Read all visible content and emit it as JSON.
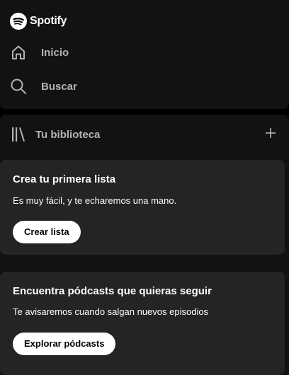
{
  "brand": {
    "name": "Spotify",
    "icon": "spotify-logo-icon",
    "color": "#1ed760"
  },
  "nav": {
    "items": [
      {
        "label": "Inicio",
        "icon": "home-icon"
      },
      {
        "label": "Buscar",
        "icon": "search-icon"
      }
    ]
  },
  "library": {
    "title": "Tu biblioteca",
    "icon": "library-icon",
    "add_icon": "plus-icon",
    "cards": [
      {
        "title": "Crea tu primera lista",
        "text": "Es muy fácil, y te echaremos una mano.",
        "button_label": "Crear lista"
      },
      {
        "title": "Encuentra pódcasts que quieras seguir",
        "text": "Te avisaremos cuando salgan nuevos episodios",
        "button_label": "Explorar pódcasts"
      }
    ]
  },
  "colors": {
    "background": "#000000",
    "panel": "#121212",
    "card": "#242424",
    "muted_text": "#b3b3b3",
    "text": "#ffffff"
  }
}
